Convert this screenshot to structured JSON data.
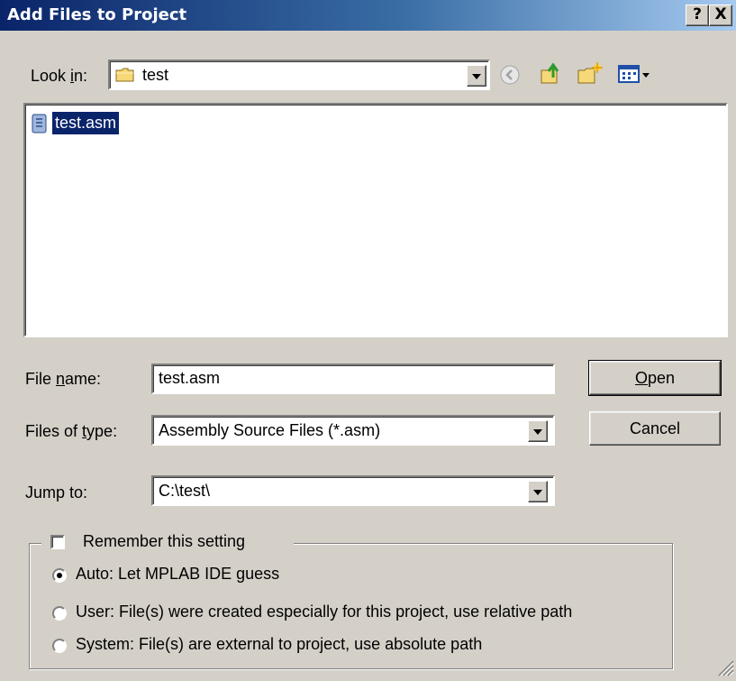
{
  "window": {
    "title": "Add Files to Project",
    "help_btn": "?",
    "close_btn": "X"
  },
  "look_in": {
    "label_pre": "Look ",
    "label_key": "i",
    "label_post": "n:",
    "value": "test",
    "icons": [
      "folder-icon",
      "back-icon",
      "up-folder-icon",
      "new-folder-icon",
      "view-menu-icon"
    ]
  },
  "file_list": {
    "items": [
      {
        "name": "test.asm",
        "icon": "asm-file-icon",
        "selected": true
      }
    ]
  },
  "file_name": {
    "label_pre": "File ",
    "label_key": "n",
    "label_post": "ame:",
    "value": "test.asm"
  },
  "files_of_type": {
    "label_pre": "Files of ",
    "label_key": "t",
    "label_post": "ype:",
    "value": "Assembly Source Files (*.asm)"
  },
  "jump_to": {
    "label": "Jump to:",
    "value": "C:\\test\\"
  },
  "buttons": {
    "open_key": "O",
    "open_rest": "pen",
    "cancel": "Cancel"
  },
  "group": {
    "remember_label": "Remember this setting",
    "remember_checked": false,
    "options": [
      {
        "label": "Auto: Let MPLAB IDE guess",
        "selected": true
      },
      {
        "label": "User: File(s) were created especially for this project, use relative path",
        "selected": false
      },
      {
        "label": "System: File(s) are external to project, use absolute path",
        "selected": false
      }
    ]
  },
  "colors": {
    "titlebar_start": "#0a246a",
    "titlebar_end": "#a6caf0",
    "dialog_bg": "#d4d0c8",
    "selection": "#0a246a"
  }
}
